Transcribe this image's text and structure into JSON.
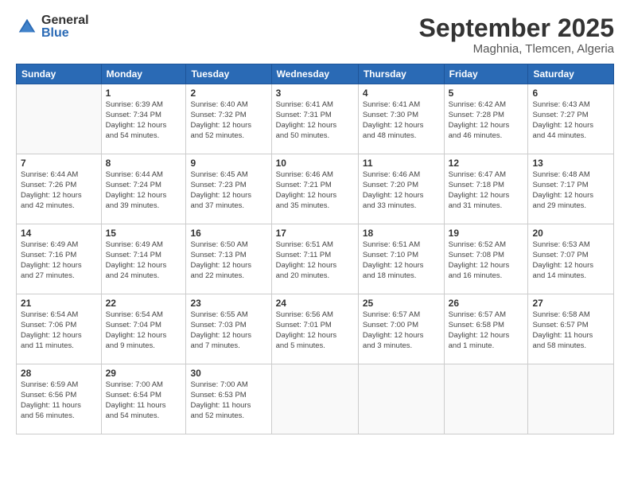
{
  "logo": {
    "general": "General",
    "blue": "Blue"
  },
  "title": {
    "month_year": "September 2025",
    "location": "Maghnia, Tlemcen, Algeria"
  },
  "headers": [
    "Sunday",
    "Monday",
    "Tuesday",
    "Wednesday",
    "Thursday",
    "Friday",
    "Saturday"
  ],
  "weeks": [
    [
      {
        "day": "",
        "info": ""
      },
      {
        "day": "1",
        "info": "Sunrise: 6:39 AM\nSunset: 7:34 PM\nDaylight: 12 hours\nand 54 minutes."
      },
      {
        "day": "2",
        "info": "Sunrise: 6:40 AM\nSunset: 7:32 PM\nDaylight: 12 hours\nand 52 minutes."
      },
      {
        "day": "3",
        "info": "Sunrise: 6:41 AM\nSunset: 7:31 PM\nDaylight: 12 hours\nand 50 minutes."
      },
      {
        "day": "4",
        "info": "Sunrise: 6:41 AM\nSunset: 7:30 PM\nDaylight: 12 hours\nand 48 minutes."
      },
      {
        "day": "5",
        "info": "Sunrise: 6:42 AM\nSunset: 7:28 PM\nDaylight: 12 hours\nand 46 minutes."
      },
      {
        "day": "6",
        "info": "Sunrise: 6:43 AM\nSunset: 7:27 PM\nDaylight: 12 hours\nand 44 minutes."
      }
    ],
    [
      {
        "day": "7",
        "info": "Sunrise: 6:44 AM\nSunset: 7:26 PM\nDaylight: 12 hours\nand 42 minutes."
      },
      {
        "day": "8",
        "info": "Sunrise: 6:44 AM\nSunset: 7:24 PM\nDaylight: 12 hours\nand 39 minutes."
      },
      {
        "day": "9",
        "info": "Sunrise: 6:45 AM\nSunset: 7:23 PM\nDaylight: 12 hours\nand 37 minutes."
      },
      {
        "day": "10",
        "info": "Sunrise: 6:46 AM\nSunset: 7:21 PM\nDaylight: 12 hours\nand 35 minutes."
      },
      {
        "day": "11",
        "info": "Sunrise: 6:46 AM\nSunset: 7:20 PM\nDaylight: 12 hours\nand 33 minutes."
      },
      {
        "day": "12",
        "info": "Sunrise: 6:47 AM\nSunset: 7:18 PM\nDaylight: 12 hours\nand 31 minutes."
      },
      {
        "day": "13",
        "info": "Sunrise: 6:48 AM\nSunset: 7:17 PM\nDaylight: 12 hours\nand 29 minutes."
      }
    ],
    [
      {
        "day": "14",
        "info": "Sunrise: 6:49 AM\nSunset: 7:16 PM\nDaylight: 12 hours\nand 27 minutes."
      },
      {
        "day": "15",
        "info": "Sunrise: 6:49 AM\nSunset: 7:14 PM\nDaylight: 12 hours\nand 24 minutes."
      },
      {
        "day": "16",
        "info": "Sunrise: 6:50 AM\nSunset: 7:13 PM\nDaylight: 12 hours\nand 22 minutes."
      },
      {
        "day": "17",
        "info": "Sunrise: 6:51 AM\nSunset: 7:11 PM\nDaylight: 12 hours\nand 20 minutes."
      },
      {
        "day": "18",
        "info": "Sunrise: 6:51 AM\nSunset: 7:10 PM\nDaylight: 12 hours\nand 18 minutes."
      },
      {
        "day": "19",
        "info": "Sunrise: 6:52 AM\nSunset: 7:08 PM\nDaylight: 12 hours\nand 16 minutes."
      },
      {
        "day": "20",
        "info": "Sunrise: 6:53 AM\nSunset: 7:07 PM\nDaylight: 12 hours\nand 14 minutes."
      }
    ],
    [
      {
        "day": "21",
        "info": "Sunrise: 6:54 AM\nSunset: 7:06 PM\nDaylight: 12 hours\nand 11 minutes."
      },
      {
        "day": "22",
        "info": "Sunrise: 6:54 AM\nSunset: 7:04 PM\nDaylight: 12 hours\nand 9 minutes."
      },
      {
        "day": "23",
        "info": "Sunrise: 6:55 AM\nSunset: 7:03 PM\nDaylight: 12 hours\nand 7 minutes."
      },
      {
        "day": "24",
        "info": "Sunrise: 6:56 AM\nSunset: 7:01 PM\nDaylight: 12 hours\nand 5 minutes."
      },
      {
        "day": "25",
        "info": "Sunrise: 6:57 AM\nSunset: 7:00 PM\nDaylight: 12 hours\nand 3 minutes."
      },
      {
        "day": "26",
        "info": "Sunrise: 6:57 AM\nSunset: 6:58 PM\nDaylight: 12 hours\nand 1 minute."
      },
      {
        "day": "27",
        "info": "Sunrise: 6:58 AM\nSunset: 6:57 PM\nDaylight: 11 hours\nand 58 minutes."
      }
    ],
    [
      {
        "day": "28",
        "info": "Sunrise: 6:59 AM\nSunset: 6:56 PM\nDaylight: 11 hours\nand 56 minutes."
      },
      {
        "day": "29",
        "info": "Sunrise: 7:00 AM\nSunset: 6:54 PM\nDaylight: 11 hours\nand 54 minutes."
      },
      {
        "day": "30",
        "info": "Sunrise: 7:00 AM\nSunset: 6:53 PM\nDaylight: 11 hours\nand 52 minutes."
      },
      {
        "day": "",
        "info": ""
      },
      {
        "day": "",
        "info": ""
      },
      {
        "day": "",
        "info": ""
      },
      {
        "day": "",
        "info": ""
      }
    ]
  ]
}
